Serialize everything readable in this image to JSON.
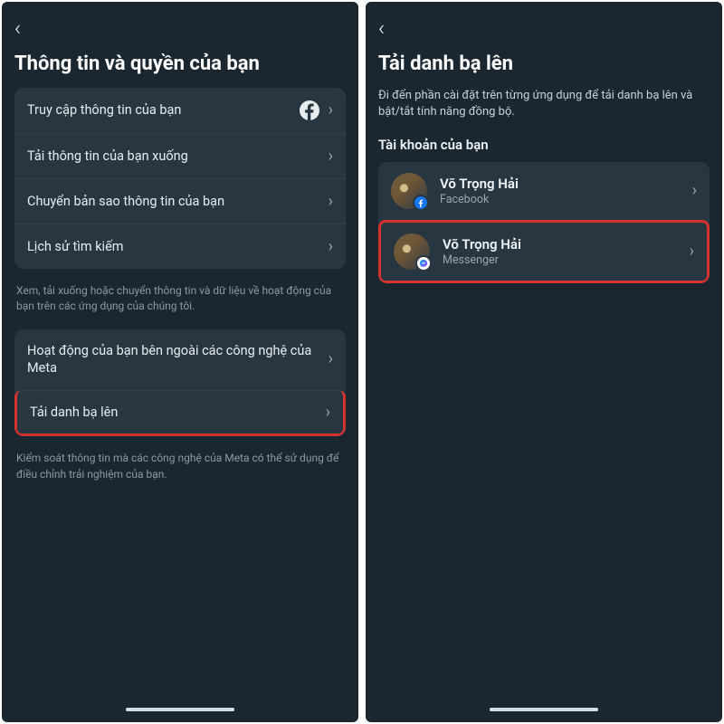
{
  "icons": {
    "facebook": "facebook-icon",
    "messenger": "messenger-icon",
    "chevron_right": "›",
    "back": "‹"
  },
  "left": {
    "title": "Thông tin và quyền của bạn",
    "group1": [
      {
        "label": "Truy cập thông tin của bạn",
        "icon": "facebook"
      },
      {
        "label": "Tải thông tin của bạn xuống"
      },
      {
        "label": "Chuyển bản sao thông tin của bạn"
      },
      {
        "label": "Lịch sử tìm kiếm"
      }
    ],
    "caption1": "Xem, tải xuống hoặc chuyển thông tin và dữ liệu về hoạt động của bạn trên các ứng dụng của chúng tôi.",
    "group2": [
      {
        "label": "Hoạt động của bạn bên ngoài các công nghệ của Meta"
      },
      {
        "label": "Tải danh bạ lên",
        "highlight": true
      }
    ],
    "caption2": "Kiểm soát thông tin mà các công nghệ của Meta có thể sử dụng để điều chỉnh trải nghiệm của bạn."
  },
  "right": {
    "title": "Tải danh bạ lên",
    "subtitle": "Đi đến phần cài đặt trên từng ứng dụng để tải danh bạ lên và bật/tắt tính năng đồng bộ.",
    "section_label": "Tài khoản của bạn",
    "accounts": [
      {
        "name": "Võ Trọng Hải",
        "app": "Facebook",
        "badge": "fb"
      },
      {
        "name": "Võ Trọng Hải",
        "app": "Messenger",
        "badge": "msg",
        "highlight": true
      }
    ]
  }
}
